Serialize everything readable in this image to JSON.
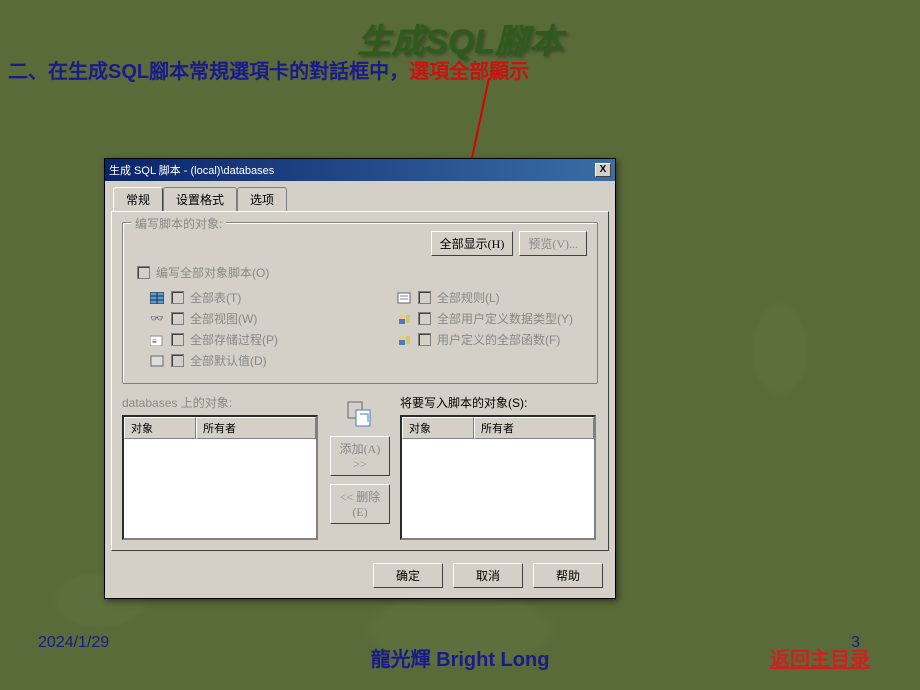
{
  "slide": {
    "title": "生成SQL腳本",
    "instruction_prefix": "二、在生成SQL腳本常規選項卡的對話框中，",
    "instruction_highlight": "選項全部顯示",
    "date": "2024/1/29",
    "page_number": "3",
    "author": "龍光輝   Bright Long",
    "back_link": "返回主目录"
  },
  "dialog": {
    "title": "生成 SQL 脚本 -  (local)\\databases",
    "close": "X",
    "tabs": [
      "常规",
      "设置格式",
      "选项"
    ],
    "group1": {
      "label": "编写脚本的对象:",
      "btn_show_all": "全部显示(H)",
      "btn_preview": "预览(V)...",
      "chk_all_objects": "编写全部对象脚本(O)",
      "left_checks": [
        {
          "icon": "table",
          "label": "全部表(T)"
        },
        {
          "icon": "glasses",
          "label": "全部视图(W)"
        },
        {
          "icon": "sp",
          "label": "全部存储过程(P)"
        },
        {
          "icon": "box",
          "label": "全部默认值(D)"
        }
      ],
      "right_checks": [
        {
          "icon": "rule",
          "label": "全部规则(L)"
        },
        {
          "icon": "user",
          "label": "全部用户定义数据类型(Y)"
        },
        {
          "icon": "user",
          "label": "用户定义的全部函数(F)"
        }
      ]
    },
    "lists": {
      "left_label": "databases 上的对象:",
      "right_label": "将要写入脚本的对象(S):",
      "col_object": "对象",
      "col_owner": "所有者"
    },
    "buttons": {
      "add": "添加(A) >>",
      "remove": "<< 删除(E)",
      "ok": "确定",
      "cancel": "取消",
      "help": "帮助"
    }
  }
}
